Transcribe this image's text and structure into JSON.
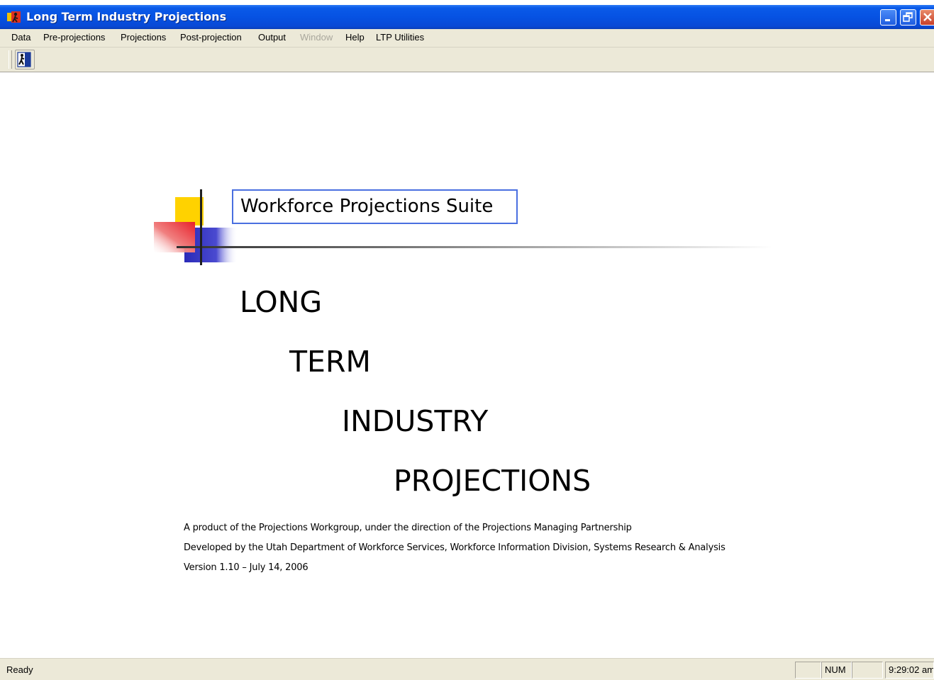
{
  "window": {
    "title": "Long Term Industry Projections"
  },
  "menu": {
    "items": [
      {
        "label": "Data",
        "enabled": true
      },
      {
        "label": "Pre-projections",
        "enabled": true
      },
      {
        "label": "Projections",
        "enabled": true
      },
      {
        "label": "Post-projection",
        "enabled": true
      },
      {
        "label": "Output",
        "enabled": true
      },
      {
        "label": "Window",
        "enabled": false
      },
      {
        "label": "Help",
        "enabled": true
      },
      {
        "label": "LTP Utilities",
        "enabled": true
      }
    ]
  },
  "toolbar": {
    "buttons": [
      {
        "icon": "exit-door-icon"
      }
    ]
  },
  "splash": {
    "suite_title": "Workforce Projections Suite",
    "words": [
      "LONG",
      "TERM",
      "INDUSTRY",
      "PROJECTIONS"
    ],
    "credits": [
      "A product of the Projections Workgroup, under the direction of the Projections Managing Partnership",
      "Developed by the Utah Department of Workforce Services, Workforce Information Division, Systems Research & Analysis",
      "Version 1.10 – July 14, 2006"
    ]
  },
  "status": {
    "text": "Ready",
    "panes": [
      "",
      "NUM",
      "",
      "9:29:02 am"
    ]
  },
  "colors": {
    "title_bar": "#0652e3",
    "menu_bg": "#ece9d8",
    "logo_yellow": "#ffd200",
    "logo_red": "#e8202a",
    "logo_blue": "#2a2ab8",
    "suite_border": "#4a6fe0"
  }
}
